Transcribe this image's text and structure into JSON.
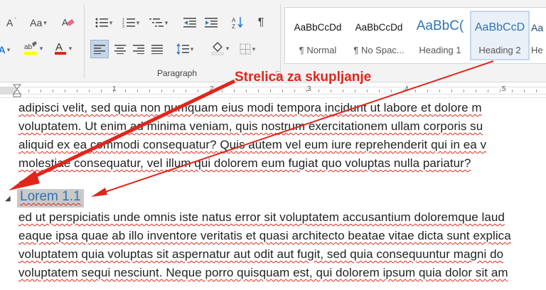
{
  "ribbon": {
    "font_buttons": [
      "A",
      "Aa",
      "A",
      "A"
    ],
    "paragraph_label": "Paragraph",
    "styles": [
      {
        "sample": "AaBbCcDd",
        "name": "¶ Normal"
      },
      {
        "sample": "AaBbCcDd",
        "name": "¶ No Spac..."
      },
      {
        "sample": "AaBbC(",
        "name": "Heading 1"
      },
      {
        "sample": "AaBbCcD",
        "name": "Heading 2"
      },
      {
        "sample": "Aa",
        "name": "He"
      }
    ],
    "ruler_numbers": [
      "1",
      "2",
      "3",
      "4",
      "5"
    ]
  },
  "annotation": {
    "label": "Strelica za skupljanje",
    "color": "#e0261b"
  },
  "document": {
    "lines_top": [
      "adipisci velit, sed quia non numquam eius modi tempora incidunt ut labore et dolore m",
      "voluptatem. Ut enim ad minima veniam, quis nostrum exercitationem ullam corporis su",
      "aliquid ex ea commodi consequatur? Quis autem vel eum iure reprehenderit qui in ea v",
      "molestiae consequatur, vel illum qui dolorem eum fugiat quo voluptas nulla pariatur?"
    ],
    "heading": "Lorem 1.1",
    "lines_bottom": [
      "ed ut perspiciatis unde omnis iste natus error sit voluptatem accusantium doloremque laud",
      "eaque ipsa quae ab illo inventore veritatis et quasi architecto beatae vitae dicta sunt explica",
      "voluptatem quia voluptas sit aspernatur aut odit aut fugit, sed quia consequuntur magni do",
      "voluptatem sequi nesciunt. Neque porro quisquam est, qui dolorem ipsum quia dolor sit am"
    ]
  }
}
